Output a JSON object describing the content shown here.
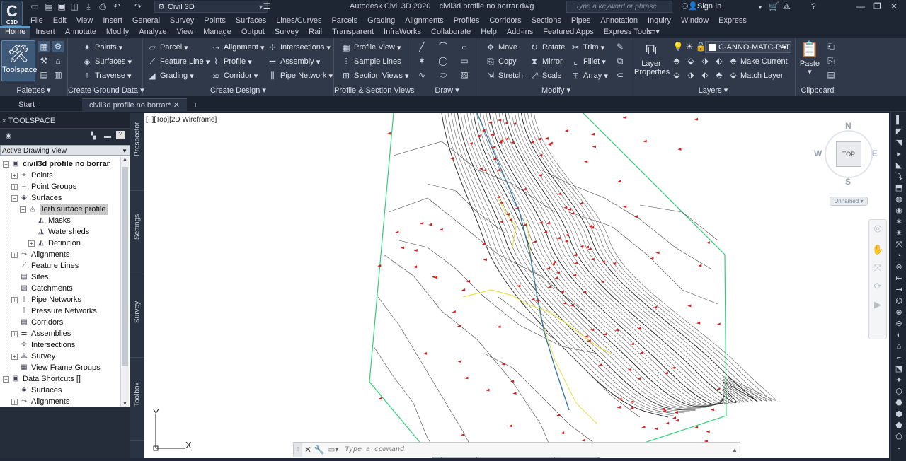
{
  "titlebar": {
    "logo_text": "C3D",
    "workspace": "Civil 3D",
    "app_name": "Autodesk Civil 3D 2020",
    "file_name": "civil3d profile no borrar.dwg",
    "search_placeholder": "Type a keyword or phrase",
    "sign_in": "Sign In"
  },
  "menubar": [
    "File",
    "Edit",
    "View",
    "Insert",
    "General",
    "Survey",
    "Points",
    "Surfaces",
    "Lines/Curves",
    "Parcels",
    "Grading",
    "Alignments",
    "Profiles",
    "Corridors",
    "Sections",
    "Pipes",
    "Annotation",
    "Inquiry",
    "Window",
    "Express"
  ],
  "ribbon_tabs": [
    "Home",
    "Insert",
    "Annotate",
    "Modify",
    "Analyze",
    "View",
    "Manage",
    "Output",
    "Survey",
    "Rail",
    "Transparent",
    "InfraWorks",
    "Collaborate",
    "Help",
    "Add-ins",
    "Featured Apps",
    "Express Tools"
  ],
  "ribbon": {
    "palettes": {
      "title": "Palettes",
      "toolspace": "Toolspace"
    },
    "ground": {
      "title": "Create Ground Data",
      "points": "Points",
      "surfaces": "Surfaces",
      "traverse": "Traverse"
    },
    "design": {
      "title": "Create Design",
      "parcel": "Parcel",
      "feature_line": "Feature Line",
      "grading": "Grading",
      "alignment": "Alignment",
      "profile": "Profile",
      "corridor": "Corridor",
      "intersections": "Intersections",
      "assembly": "Assembly",
      "pipe_network": "Pipe Network"
    },
    "psv": {
      "title": "Profile & Section Views",
      "profile_view": "Profile View",
      "sample_lines": "Sample Lines",
      "section_views": "Section Views"
    },
    "draw": {
      "title": "Draw"
    },
    "modify": {
      "title": "Modify",
      "move": "Move",
      "copy": "Copy",
      "stretch": "Stretch",
      "rotate": "Rotate",
      "mirror": "Mirror",
      "scale": "Scale",
      "trim": "Trim",
      "fillet": "Fillet",
      "array": "Array"
    },
    "layers": {
      "title": "Layers",
      "layer_properties": "Layer Properties",
      "current_layer": "C-ANNO-MATC-PAT",
      "make_current": "Make Current",
      "match_layer": "Match Layer"
    },
    "clipboard": {
      "title": "Clipboard",
      "paste": "Paste"
    }
  },
  "doc_tabs": {
    "start": "Start",
    "drawing": "civil3d profile no borrar*"
  },
  "toolspace": {
    "title": "TOOLSPACE",
    "view": "Active Drawing View",
    "tree": [
      {
        "label": "civil3d profile no borrar",
        "bold": true
      },
      {
        "label": "Points"
      },
      {
        "label": "Point Groups"
      },
      {
        "label": "Surfaces"
      },
      {
        "label": "lerh surface profile"
      },
      {
        "label": "Masks"
      },
      {
        "label": "Watersheds"
      },
      {
        "label": "Definition"
      },
      {
        "label": "Alignments"
      },
      {
        "label": "Feature Lines"
      },
      {
        "label": "Sites"
      },
      {
        "label": "Catchments"
      },
      {
        "label": "Pipe Networks"
      },
      {
        "label": "Pressure Networks"
      },
      {
        "label": "Corridors"
      },
      {
        "label": "Assemblies"
      },
      {
        "label": "Intersections"
      },
      {
        "label": "Survey"
      },
      {
        "label": "View Frame Groups"
      },
      {
        "label": "Data Shortcuts []"
      },
      {
        "label": "Surfaces"
      },
      {
        "label": "Alignments"
      }
    ],
    "vtabs": [
      "Prospector",
      "Settings",
      "Survey",
      "Toolbox"
    ]
  },
  "viewport": {
    "label": "[−][Top][2D Wireframe]",
    "viewcube": {
      "n": "N",
      "s": "S",
      "e": "E",
      "w": "W",
      "top": "TOP",
      "ucs_name": "Unnamed"
    },
    "ucs": {
      "x": "X",
      "y": "Y"
    }
  },
  "command": {
    "placeholder": "Type a command"
  },
  "colors": {
    "accent": "#4aa3df",
    "ribbon": "#2f394a",
    "boundary": "#2fcf7a",
    "contour": "#333333",
    "point": "#d0201f",
    "stream": "#e6e04a",
    "alignment": "#3a78a8"
  }
}
